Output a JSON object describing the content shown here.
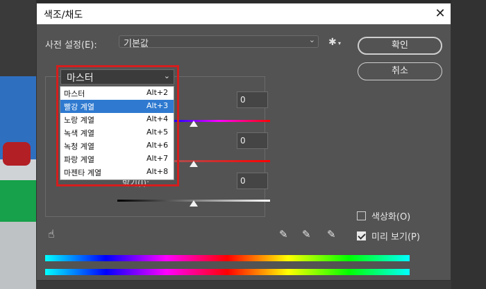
{
  "dialog": {
    "title": "색조/채도",
    "close": "✕"
  },
  "preset": {
    "label": "사전 설정(E):",
    "value": "기본값"
  },
  "buttons": {
    "ok": "확인",
    "cancel": "취소"
  },
  "channel": {
    "selected": "마스터",
    "options": [
      {
        "label": "마스터",
        "shortcut": "Alt+2"
      },
      {
        "label": "빨강 계열",
        "shortcut": "Alt+3",
        "highlighted": true
      },
      {
        "label": "노랑 계열",
        "shortcut": "Alt+4"
      },
      {
        "label": "녹색 계열",
        "shortcut": "Alt+5"
      },
      {
        "label": "녹청 계열",
        "shortcut": "Alt+6"
      },
      {
        "label": "파랑 계열",
        "shortcut": "Alt+7"
      },
      {
        "label": "마젠타 계열",
        "shortcut": "Alt+8"
      }
    ]
  },
  "sliders": {
    "hue": {
      "value": "0"
    },
    "saturation": {
      "value": "0"
    },
    "lightness": {
      "label": "밝기(I):",
      "value": "0"
    }
  },
  "options": {
    "colorize": {
      "label": "색상화(O)",
      "checked": false
    },
    "preview": {
      "label": "미리 보기(P)",
      "checked": true
    }
  },
  "colors": {
    "dialog_bg": "#535353",
    "highlight": "#2f7ad0",
    "outline": "#d61d1d"
  }
}
